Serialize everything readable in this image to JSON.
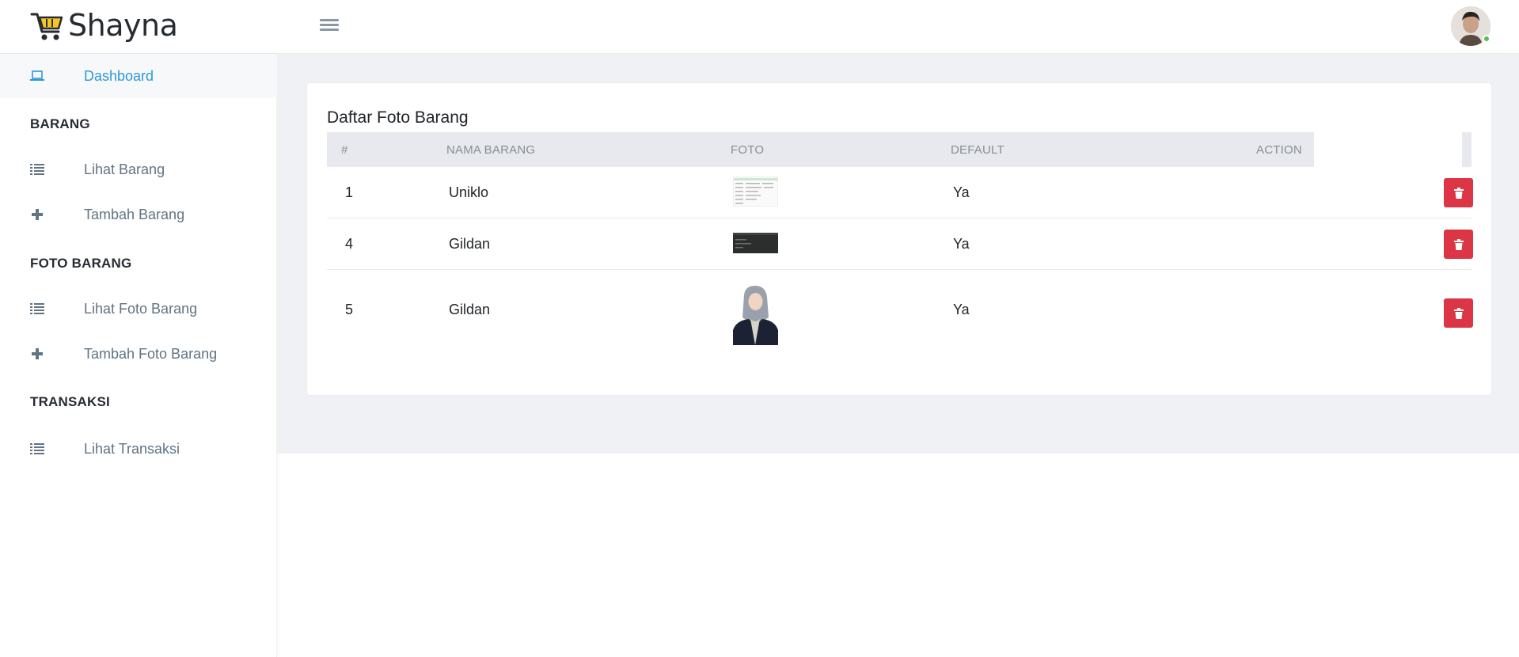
{
  "app": {
    "brand": "Shayna"
  },
  "header": {
    "menu_icon": "hamburger-icon",
    "avatar": "user-avatar"
  },
  "sidebar": {
    "dashboard": "Dashboard",
    "sections": [
      {
        "heading": "BARANG",
        "items": [
          "Lihat Barang",
          "Tambah Barang"
        ]
      },
      {
        "heading": "FOTO BARANG",
        "items": [
          "Lihat Foto Barang",
          "Tambah Foto Barang"
        ]
      },
      {
        "heading": "TRANSAKSI",
        "items": [
          "Lihat Transaksi"
        ]
      }
    ]
  },
  "main": {
    "title": "Daftar Foto Barang",
    "columns": [
      "#",
      "NAMA BARANG",
      "FOTO",
      "DEFAULT",
      "ACTION"
    ],
    "rows": [
      {
        "id": "1",
        "nama": "Uniklo",
        "default": "Ya"
      },
      {
        "id": "4",
        "nama": "Gildan",
        "default": "Ya"
      },
      {
        "id": "5",
        "nama": "Gildan",
        "default": "Ya"
      }
    ]
  },
  "colors": {
    "accent": "#2d9ad7",
    "danger": "#dc3545",
    "background": "#f0f1f5"
  }
}
